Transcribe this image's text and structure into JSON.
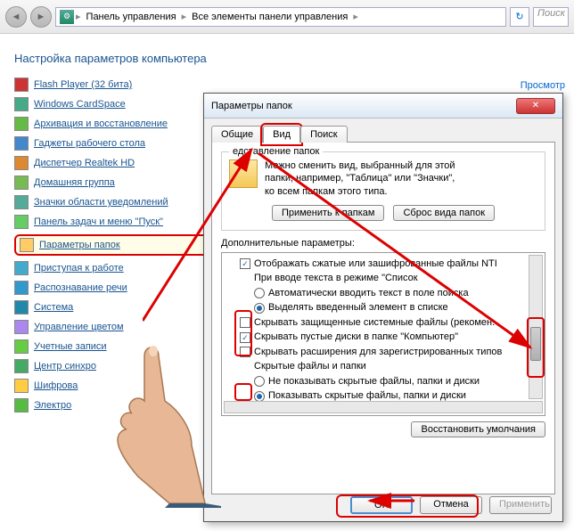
{
  "nav": {
    "crumb1": "Панель управления",
    "crumb2": "Все элементы панели управления",
    "search": "Поиск"
  },
  "main": {
    "title": "Настройка параметров компьютера",
    "corner": "Просмотр"
  },
  "items": [
    "Flash Player (32 бита)",
    "Windows CardSpace",
    "Архивация и восстановление",
    "Гаджеты рабочего стола",
    "Диспетчер Realtek HD",
    "Домашняя группа",
    "Значки области уведомлений",
    "Панель задач и меню \"Пуск\"",
    "Параметры папок",
    "Приступая к работе",
    "Распознавание речи",
    "Система",
    "Управление цветом",
    "Учетные записи",
    "Центр синхро",
    "Шифрова",
    "Электро"
  ],
  "dialog": {
    "title": "Параметры папок",
    "tabs": [
      "Общие",
      "Вид",
      "Поиск"
    ],
    "group_label": "едставление папок",
    "group_text1": "Можно сменить вид, выбранный для этой",
    "group_text2": "папки, например, \"Таблица\" или \"Значки\",",
    "group_text3": "ко всем папкам этого типа.",
    "apply_folders": "Применить к папкам",
    "reset_folders": "Сброс вида папок",
    "adv_label": "Дополнительные параметры:",
    "adv": [
      "Отображать сжатые или зашифрованные файлы NTI",
      "При вводе текста в режиме \"Список",
      "Автоматически вводить текст в поле поиска",
      "Выделять введенный элемент в списке",
      "Скрывать защищенные системные файлы (рекомен.",
      "Скрывать пустые диски в папке \"Компьютер\"",
      "Скрывать расширения для зарегистрированных типов",
      "Скрытые файлы и папки",
      "Не показывать скрытые файлы, папки и диски",
      "Показывать скрытые файлы, папки и диски"
    ],
    "restore": "Восстановить умолчания",
    "ok": "OK",
    "cancel": "Отмена",
    "apply": "Применить"
  }
}
